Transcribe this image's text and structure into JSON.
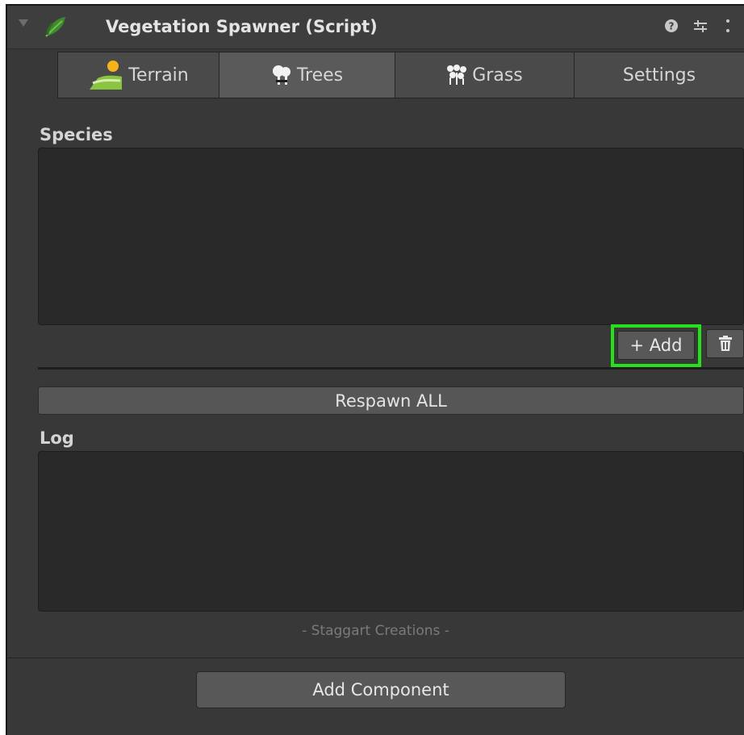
{
  "component": {
    "title": "Vegetation Spawner (Script)",
    "help_icon": "help-icon",
    "settings_icon": "presets-icon",
    "menu_icon": "kebab-menu-icon"
  },
  "tabs": [
    {
      "label": "Terrain",
      "icon": "terrain-icon",
      "active": false
    },
    {
      "label": "Trees",
      "icon": "trees-icon",
      "active": true
    },
    {
      "label": "Grass",
      "icon": "grass-icon",
      "active": false
    },
    {
      "label": "Settings",
      "icon": "",
      "active": false
    }
  ],
  "species": {
    "label": "Species",
    "add_label": "+ Add",
    "delete_icon": "trash-icon"
  },
  "respawn_label": "Respawn ALL",
  "log": {
    "label": "Log"
  },
  "footer_note": "- Staggart Creations -",
  "add_component_label": "Add Component",
  "colors": {
    "highlight": "#26e01a",
    "panel": "#383838",
    "box": "#292929"
  }
}
